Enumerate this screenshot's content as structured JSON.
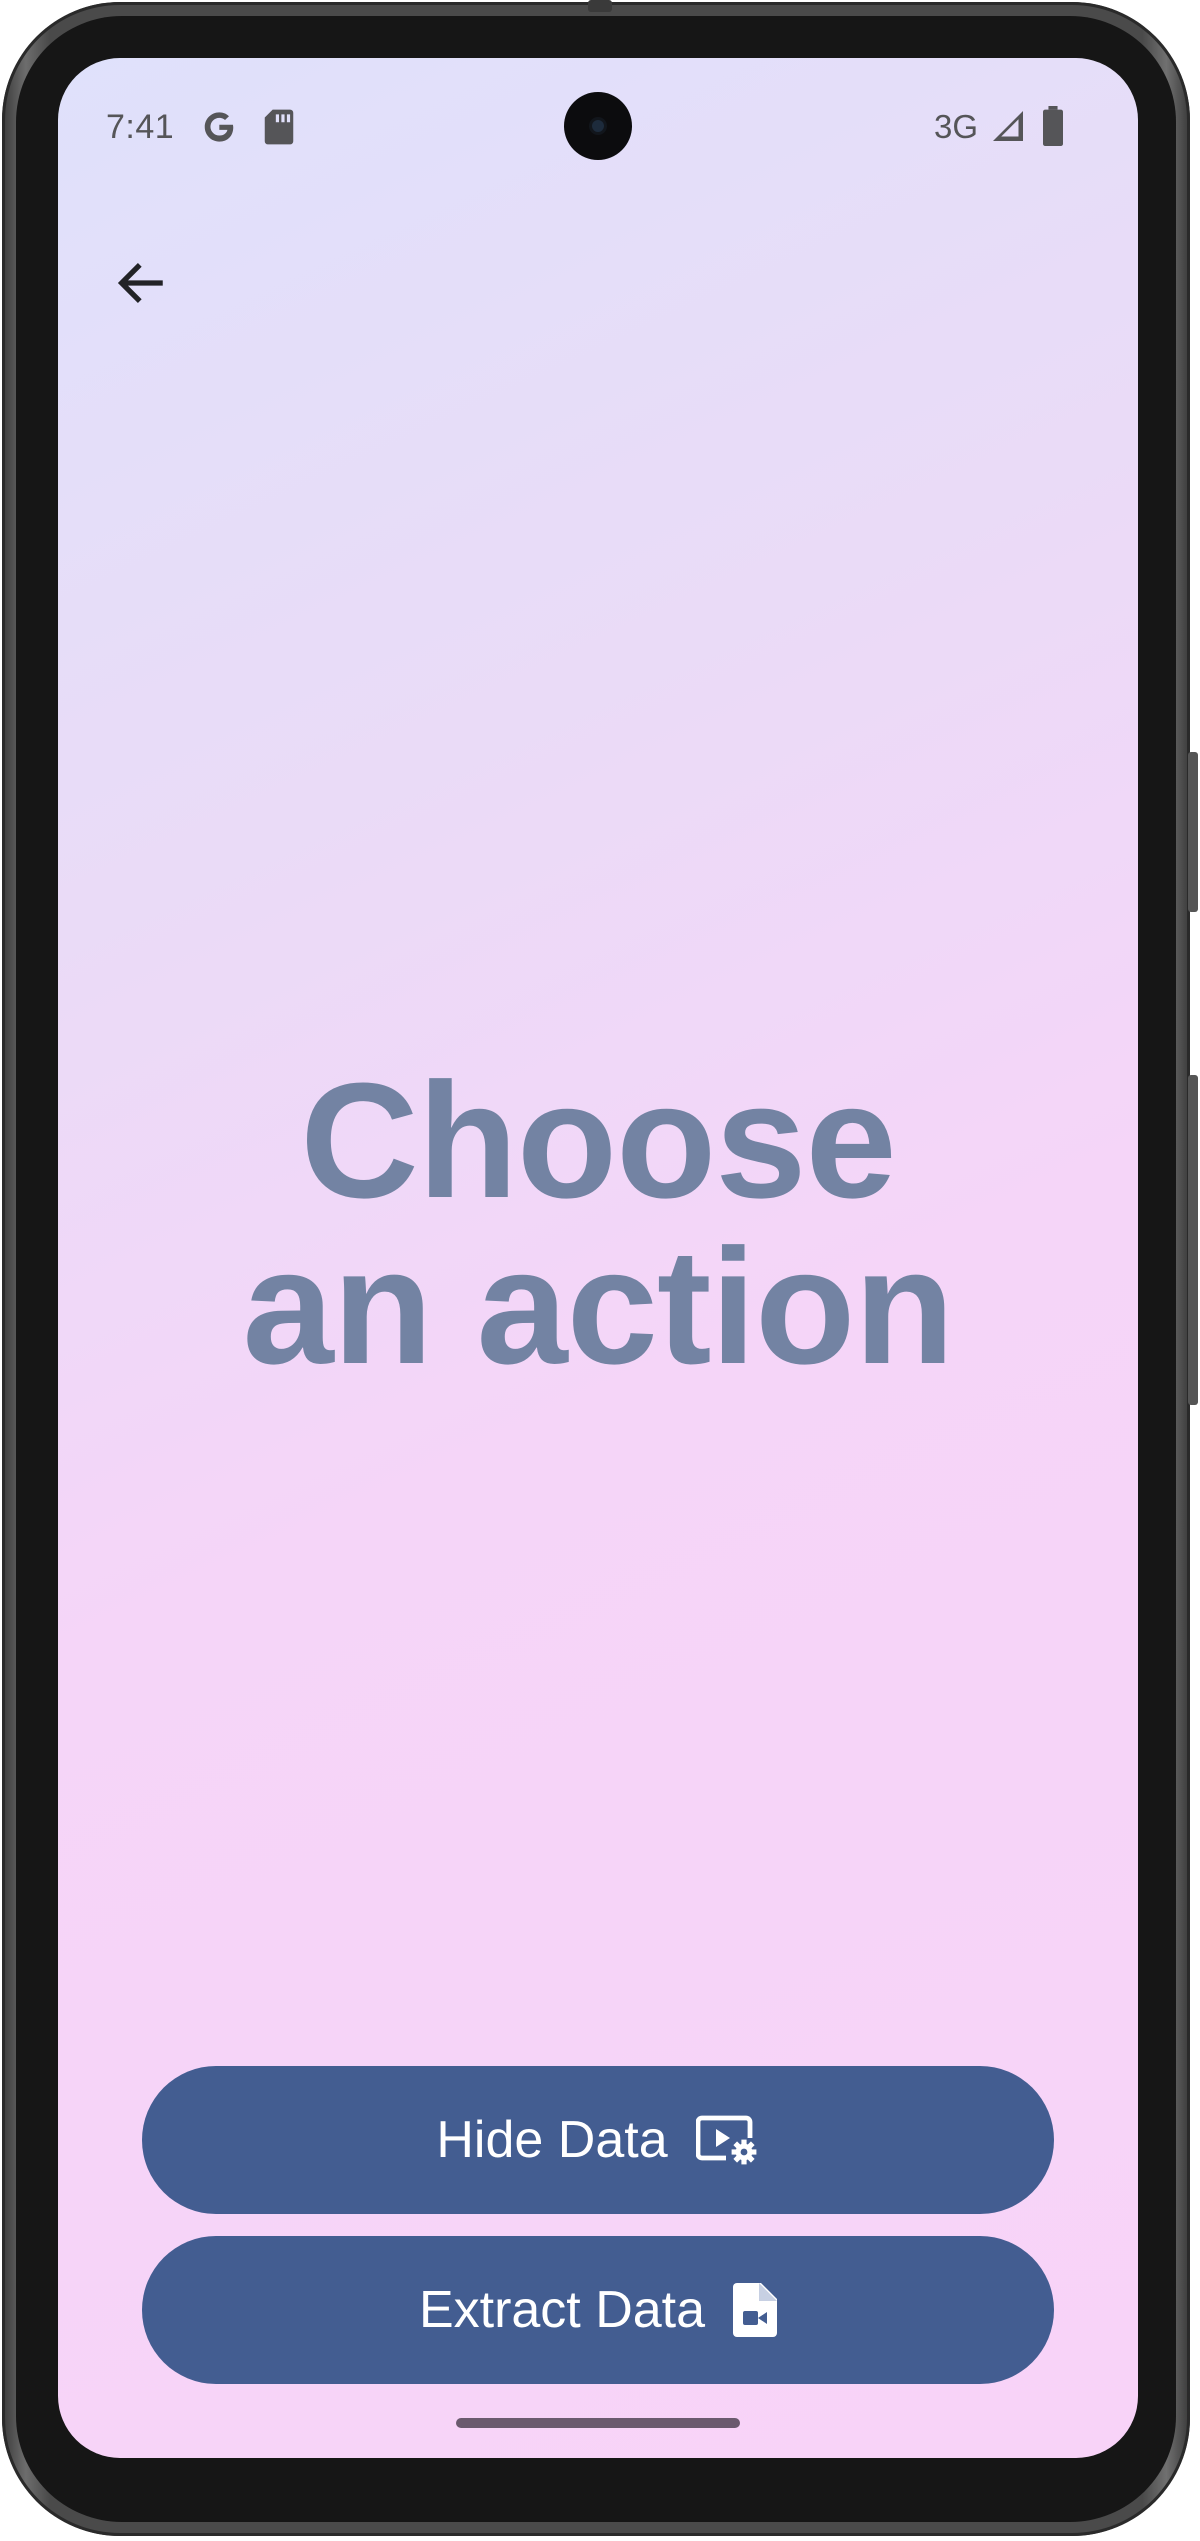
{
  "status_bar": {
    "time": "7:41",
    "network": "3G",
    "icons": [
      "google-icon",
      "sd-card-icon",
      "signal-icon",
      "battery-icon"
    ]
  },
  "app_bar": {
    "back_icon": "arrow-left-icon"
  },
  "headline": {
    "line1": "Choose",
    "line2": "an action"
  },
  "actions": {
    "hide_label": "Hide Data",
    "hide_icon": "video-settings-icon",
    "extract_label": "Extract Data",
    "extract_icon": "file-video-icon"
  },
  "colors": {
    "headline": "#7383a3",
    "button_bg": "#435d91",
    "button_text": "#ffffff",
    "background_top": "#dfe1fb",
    "background_bottom": "#f8d3f8"
  }
}
